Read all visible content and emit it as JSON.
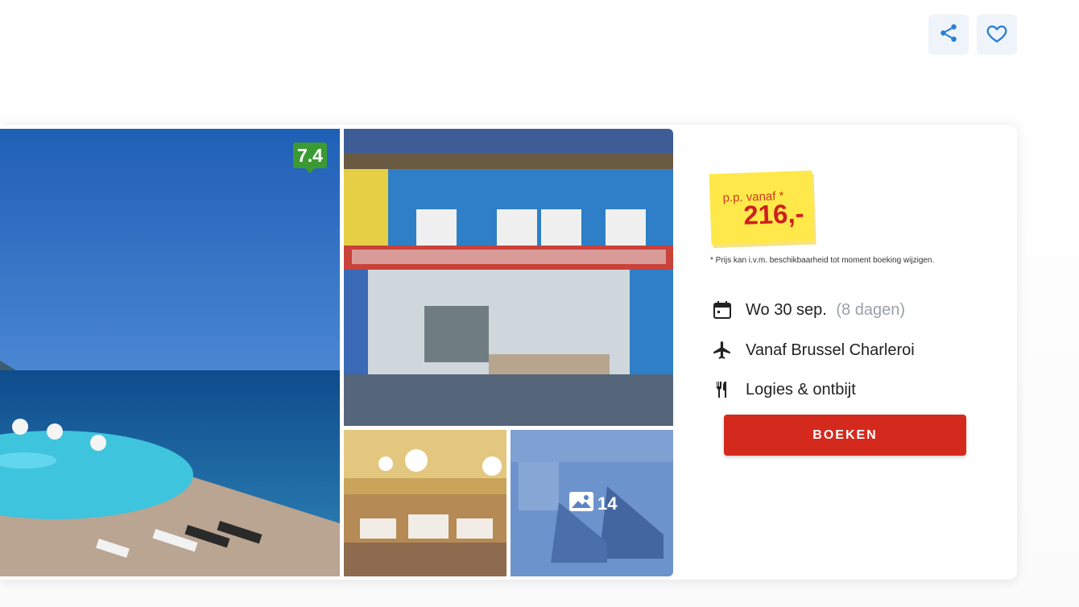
{
  "actions": {
    "share_icon": "share-icon",
    "favorite_icon": "heart-icon"
  },
  "rating": {
    "score": "7.4",
    "color": "#3c9a34"
  },
  "gallery": {
    "photo_count": "14",
    "tiles": [
      "main-photo",
      "hotel-front-photo",
      "restaurant-photo",
      "gym-photo"
    ]
  },
  "price": {
    "label": "p.p. vanaf *",
    "value": "216,-",
    "note": "* Prijs kan i.v.m. beschikbaarheid tot moment boeking wijzigen."
  },
  "details": {
    "date": "Wo 30 sep.",
    "duration": "(8 dagen)",
    "departure": "Vanaf Brussel Charleroi",
    "board": "Logies & ontbijt"
  },
  "cta": {
    "book_label": "BOEKEN",
    "color": "#d42a1e"
  }
}
